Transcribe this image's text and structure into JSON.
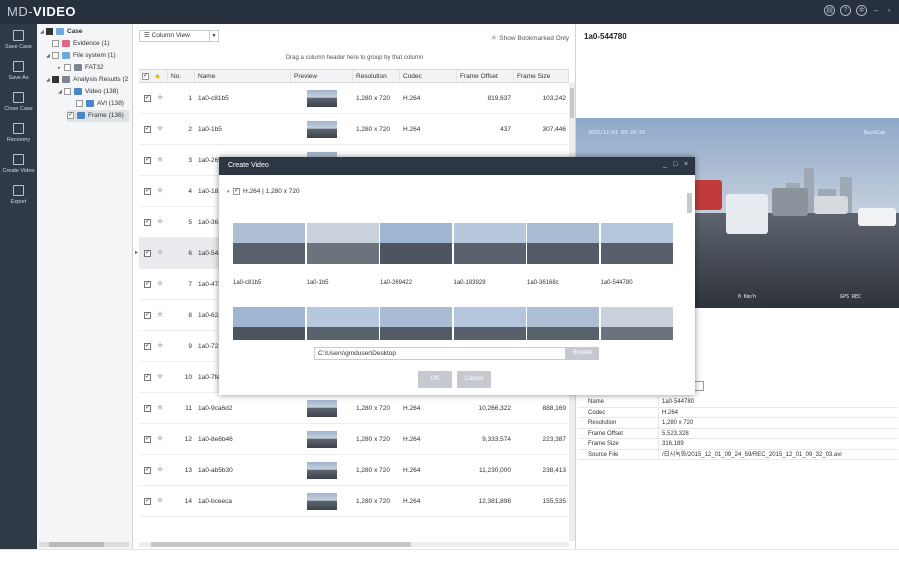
{
  "app": {
    "title_prefix": "MD-",
    "title_accent": "VIDEO"
  },
  "window_icons": [
    "report-icon",
    "help-icon",
    "settings-icon"
  ],
  "window_controls": [
    "–",
    "▫"
  ],
  "toolbar": [
    {
      "label": "Save Case",
      "icon": "save-icon"
    },
    {
      "label": "Save As",
      "icon": "save-as-icon"
    },
    {
      "label": "Close Case",
      "icon": "close-case-icon"
    },
    {
      "label": "Recovery",
      "icon": "recovery-icon"
    },
    {
      "label": "Create Video",
      "icon": "create-video-icon"
    },
    {
      "label": "Export",
      "icon": "export-icon"
    }
  ],
  "tree": [
    {
      "label": "Case",
      "bold": true
    },
    {
      "label": "Evidence (1)"
    },
    {
      "label": "File system (1)"
    },
    {
      "label": "FAT32"
    },
    {
      "label": "Analysis Results (2"
    },
    {
      "label": "Video (138)"
    },
    {
      "label": "AVI (138)"
    },
    {
      "label": "Frame (136)"
    }
  ],
  "grid": {
    "view_select": "Column View",
    "show_bookmarked": "Show Bookmarked Only",
    "group_hint": "Drag a column header here to group by that column",
    "columns": [
      "No.",
      "Name",
      "Preview",
      "Resolution",
      "Codec",
      "Frame Offset",
      "Frame Size"
    ],
    "rows": [
      {
        "no": "1",
        "name": "1a0-c81b5",
        "res": "1,280 x 720",
        "codec": "H.264",
        "offset": "819,637",
        "size": "103,242"
      },
      {
        "no": "2",
        "name": "1a0-1b5",
        "res": "1,280 x 720",
        "codec": "H.264",
        "offset": "437",
        "size": "307,446"
      },
      {
        "no": "3",
        "name": "1a0-2694"
      },
      {
        "no": "4",
        "name": "1a0-1839"
      },
      {
        "no": "5",
        "name": "1a0-3616"
      },
      {
        "no": "6",
        "name": "1a0-5447"
      },
      {
        "no": "7",
        "name": "1a0-473E"
      },
      {
        "no": "8",
        "name": "1a0-62ac"
      },
      {
        "no": "9",
        "name": "1a0-7218"
      },
      {
        "no": "10",
        "name": "1a0-7fe5"
      },
      {
        "no": "11",
        "name": "1a0-9ca6d2",
        "res": "1,280 x 720",
        "codec": "H.264",
        "offset": "10,266,322",
        "size": "888,169"
      },
      {
        "no": "12",
        "name": "1a0-8e6b46",
        "res": "1,280 x 720",
        "codec": "H.264",
        "offset": "9,333,574",
        "size": "223,387"
      },
      {
        "no": "13",
        "name": "1a0-ab5b30",
        "res": "1,280 x 720",
        "codec": "H.264",
        "offset": "11,230,000",
        "size": "238,413"
      },
      {
        "no": "14",
        "name": "1a0-bceeca",
        "res": "1,280 x 720",
        "codec": "H.264",
        "offset": "12,381,898",
        "size": "155,535"
      }
    ]
  },
  "detail": {
    "title": "1a0-544780",
    "osd_timestamp": "2015/12/01 09:24:55",
    "osd_brand": "BackCam",
    "osd_speed": "0 Km/h",
    "osd_status": "GPS  REC",
    "properties": [
      {
        "key": "Name",
        "value": "1a0-544780"
      },
      {
        "key": "Codec",
        "value": "H.264"
      },
      {
        "key": "Resolution",
        "value": "1,280 x 720"
      },
      {
        "key": "Frame Offset",
        "value": "5,523,328"
      },
      {
        "key": "Frame Size",
        "value": "316,189"
      },
      {
        "key": "Source File",
        "value": "/日시녹화/2015_12_01_09_24_59/REC_2015_12_01_09_32_03.avi"
      }
    ]
  },
  "dialog": {
    "title": "Create Video",
    "controls": [
      "_",
      "□",
      "×"
    ],
    "group_label": "H.264  |  1,280 x 720",
    "thumbnails": [
      "1a0-c81b5",
      "1a0-1b5",
      "1a0-269422",
      "1a0-183928",
      "1a0-36168c",
      "1a0-544780"
    ],
    "path": "C:\\Users\\gmduser\\Desktop",
    "browse": "Browse",
    "ok": "OK",
    "cancel": "Cancel"
  }
}
